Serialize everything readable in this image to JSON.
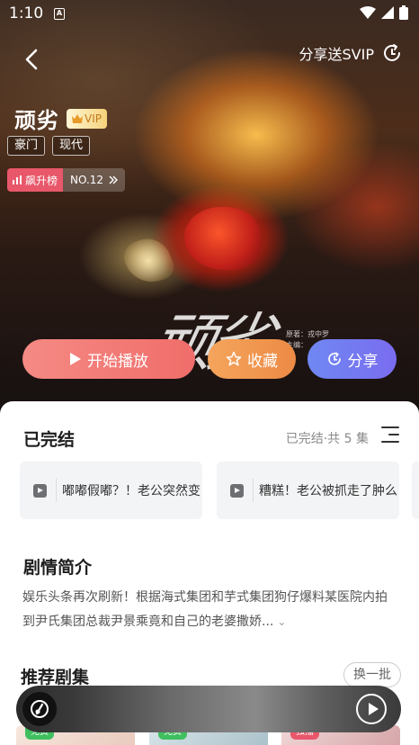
{
  "status_bar": {
    "time": "1:10",
    "notification_letter": "A"
  },
  "header": {
    "share_svip_label": "分享送SVIP"
  },
  "drama": {
    "title": "顽劣",
    "vip_label": "VIP",
    "tags": [
      "豪门",
      "现代"
    ],
    "rank_label": "飙升榜",
    "rank_value": "NO.12"
  },
  "cover": {
    "calligraphy": "顽劣",
    "credit_line1": "原著：戎中罗",
    "credit_line2": "主编："
  },
  "actions": {
    "play_label": "开始播放",
    "favorite_label": "收藏",
    "share_label": "分享"
  },
  "episodes": {
    "section_title": "已完结",
    "status": "已完结·共 5 集",
    "items": [
      {
        "text": "嘟嘟假嘟？！老公突然变"
      },
      {
        "text": "糟糕！老公被抓走了肿么"
      }
    ]
  },
  "synopsis": {
    "section_title": "剧情简介",
    "text": "娱乐头条再次刷新！根据海式集团和芋式集团狗仔爆料某医院内拍到尹氏集团总裁尹景乘竟和自己的老婆撒娇..."
  },
  "recommend": {
    "section_title": "推荐剧集",
    "refresh_label": "换一批",
    "items": [
      {
        "badge": "免费",
        "badge_color": "#3fbf5f"
      },
      {
        "badge": "免费",
        "badge_color": "#3fbf5f"
      },
      {
        "badge": "独播",
        "badge_color": "#e8576a"
      }
    ]
  },
  "colors": {
    "play": "#f06d6a",
    "favorite": "#ec8a45",
    "share": "#7a6cf0",
    "rank": "#e8576a"
  }
}
